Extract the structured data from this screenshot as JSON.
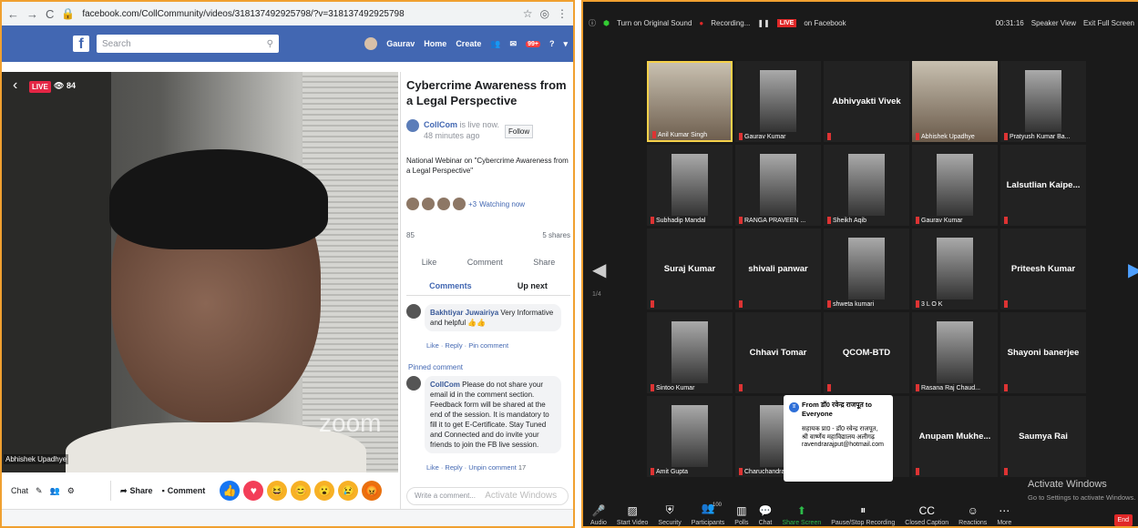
{
  "browser": {
    "url": "facebook.com/CollCommunity/videos/318137492925798/?v=318137492925798"
  },
  "fb": {
    "search_placeholder": "Search",
    "user": "Gaurav",
    "home": "Home",
    "create": "Create",
    "badge": "99+"
  },
  "video": {
    "live": "LIVE",
    "views": "84",
    "watermark": "zoom",
    "speaker": "Abhishek Upadhye",
    "share": "Share",
    "comment": "Comment",
    "chat": "Chat"
  },
  "post": {
    "title": "Cybercrime Awareness from a Legal Perspective",
    "channel": "CollCom",
    "channel_status": " is live now.",
    "time": "48 minutes ago",
    "follow": "Follow",
    "description": "National Webinar on \"Cybercrime Awareness from a Legal Perspective\"",
    "watching_count": "+3",
    "watching": "Watching now",
    "reactions": "85",
    "shares": "5 shares",
    "like": "Like",
    "comment": "Comment",
    "share": "Share",
    "tab_comments": "Comments",
    "tab_upnext": "Up next",
    "comment1_author": "Bakhtiyar Juwairiya",
    "comment1_text": " Very Informative and helpful 👍👍",
    "comment1_links": "Like · Reply · Pin comment",
    "pinned_label": "Pinned comment",
    "comment2_author": "CollCom",
    "comment2_text": " Please do not share your email id in the comment section. Feedback form will be shared at the end of the session. It is mandatory to fill it to get E-Certificate. Stay Tuned and Connected and do invite your friends to join the FB live session.",
    "comment2_links": "Like · Reply · Unpin comment",
    "comment2_count": "17",
    "write_placeholder": "Write a comment...",
    "activate": "Activate Windows",
    "activate_sub": "Go to Settings to activate Windows."
  },
  "zoom": {
    "top_sound": "Turn on Original Sound",
    "recording": "Recording...",
    "live": "LIVE",
    "on_fb": "on Facebook",
    "time": "00:31:16",
    "speaker_view": "Speaker View",
    "exit_full": "Exit Full Screen",
    "page_left": "1/4",
    "page_right": "1/4",
    "tiles": [
      "Anil Kumar Singh",
      "Gaurav Kumar",
      "Abhivyakti Vivek",
      "Abhishek Upadhye",
      "Pratyush Kumar Ba...",
      "Subhadip Mandal",
      "RANGA PRAVEEN ...",
      "Sheikh Aqib",
      "Gaurav Kumar",
      "Lalsutlian  Kaipe...",
      "Suraj Kumar",
      "shivali panwar",
      "shweta kumari",
      "3 L O K",
      "Priteesh Kumar",
      "Sintoo Kumar",
      "Chhavi Tomar",
      "QCOM-BTD",
      "Rasana Raj Chaud...",
      "Shayoni banerjee",
      "Amit Gupta",
      "Charuchandra Nish...",
      "",
      "Anupam  Mukhe...",
      "Saumya Rai"
    ],
    "popup_from": "From डॉ0 रवेन्द्र राजपूत to Everyone",
    "popup_line1": "सहायक प्रा0 - डॉ0 रवेन्द्र राजपूत,",
    "popup_line2": "श्री वार्ष्णेय महाविद्यालय अलीगढ़",
    "popup_email": "ravendrarajput@hotmail.com",
    "activate": "Activate Windows",
    "activate_sub": "Go to Settings to activate Windows.",
    "bar": [
      "Audio",
      "Start Video",
      "Security",
      "Participants",
      "Polls",
      "Chat",
      "Share Screen",
      "Pause/Stop Recording",
      "Closed Caption",
      "Reactions",
      "More"
    ],
    "participants_count": "100",
    "end": "End"
  }
}
